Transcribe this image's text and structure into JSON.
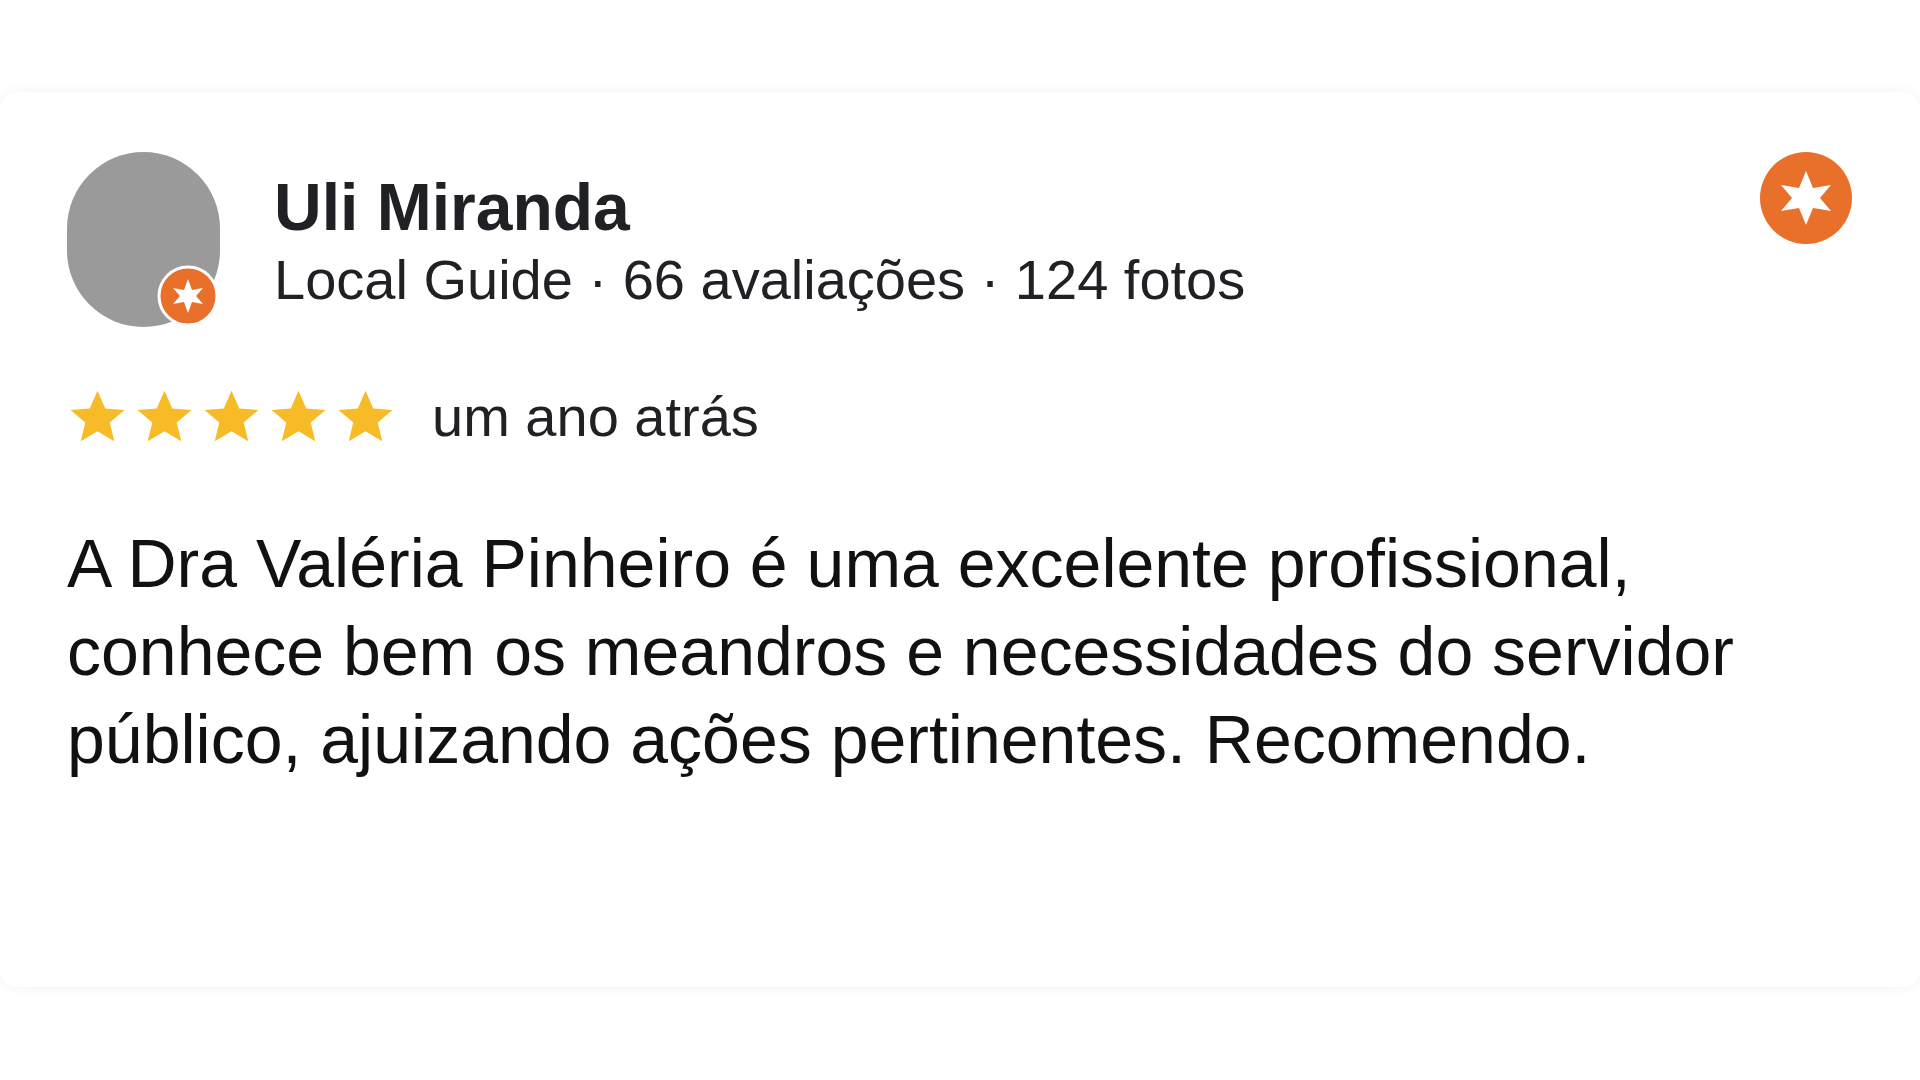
{
  "review": {
    "author": "Uli Miranda",
    "author_meta": "Local Guide · 66 avaliações · 124 fotos",
    "stars": 5,
    "time": "um ano atrás",
    "text": "A Dra Valéria Pinheiro é uma excelente profissional, conhece bem os meandros e necessidades do servidor público, ajuizando ações pertinentes. Recomendo."
  }
}
